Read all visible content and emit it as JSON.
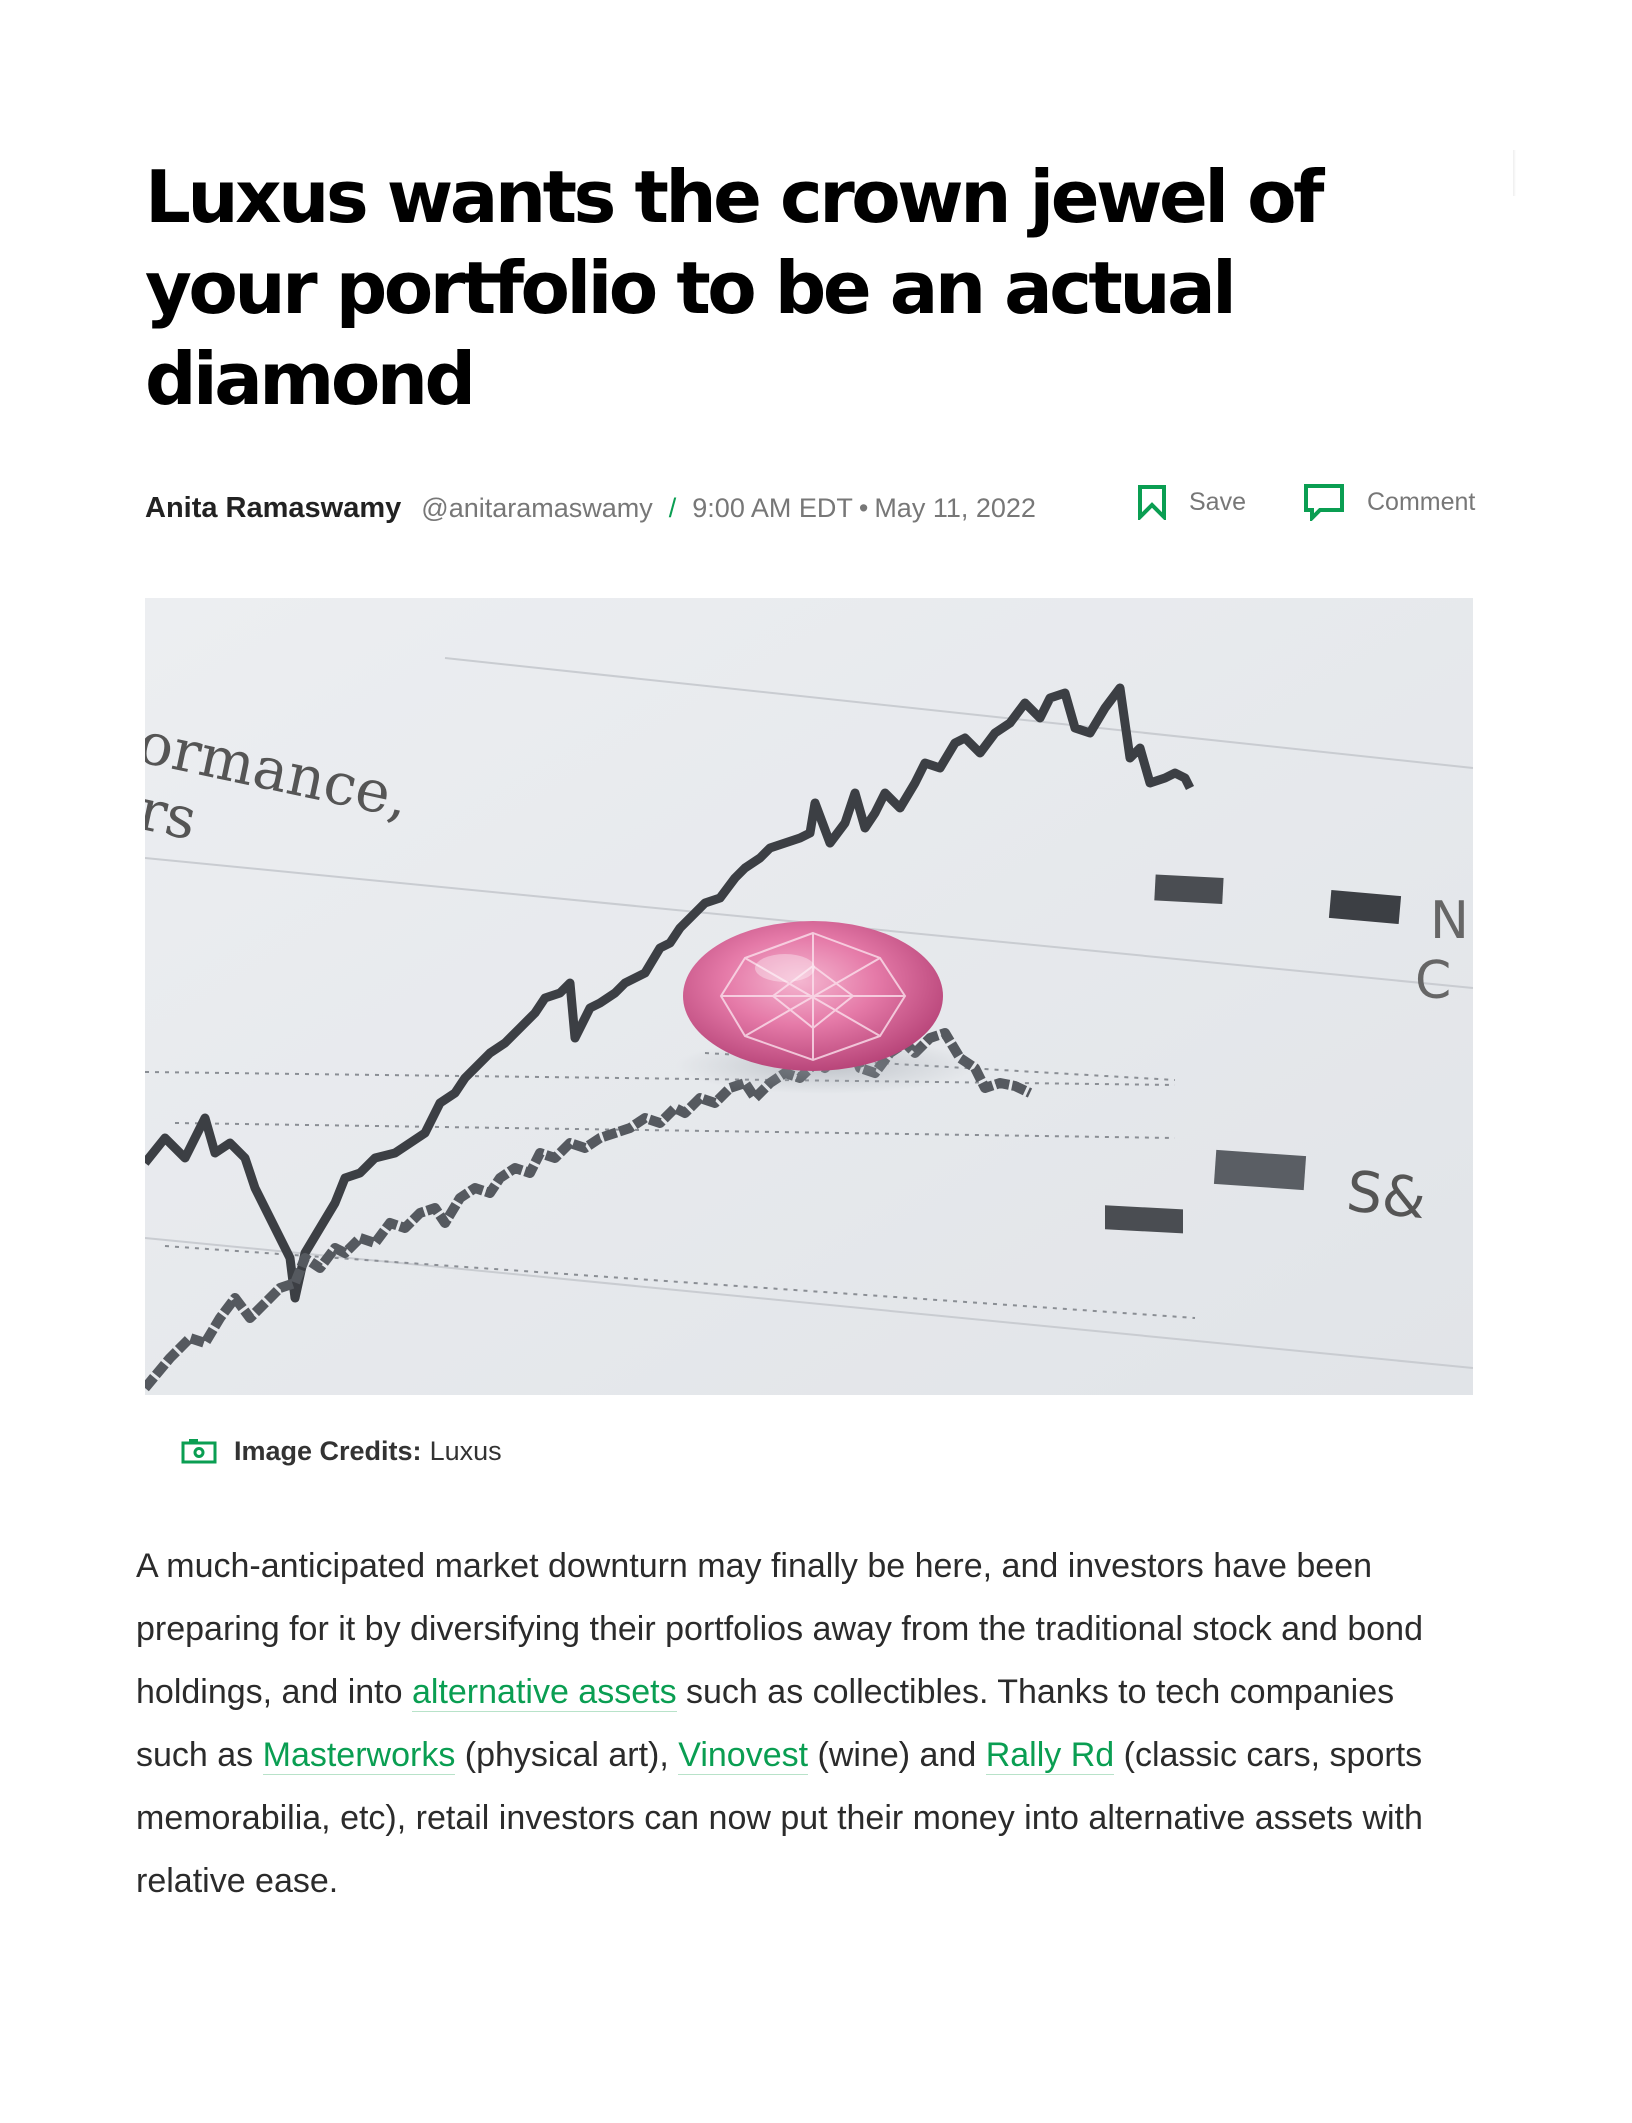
{
  "article": {
    "title": "Luxus wants the crown jewel of your portfolio to be an actual diamond",
    "author": "Anita Ramaswamy",
    "handle": "@anitaramaswamy",
    "separator": "/",
    "time": "9:00 AM EDT",
    "dot": "•",
    "date": "May 11, 2022"
  },
  "actions": {
    "save_label": "Save",
    "comment_label": "Comment"
  },
  "hero": {
    "text_top_line1": "ormance,",
    "text_top_line2": "rs",
    "text_right_1": "N",
    "text_right_2": "C",
    "text_right_3": "S&"
  },
  "credits": {
    "label": "Image Credits:",
    "value": "Luxus"
  },
  "body": {
    "seg1": "A much-anticipated market downturn may finally be here, and investors have been preparing for it by diversifying their portfolios away from the traditional stock and bond holdings, and into ",
    "link1": "alternative assets",
    "seg2": " such as collectibles. Thanks to tech companies such as ",
    "link2": "Masterworks",
    "seg3": " (physical art), ",
    "link3": "Vinovest",
    "seg4": " (wine) and ",
    "link4": "Rally Rd",
    "seg5": " (classic cars, sports memorabilia, etc), retail investors can now put their money into alternative assets with relative ease."
  },
  "colors": {
    "accent": "#0a9e52",
    "title": "#000000",
    "meta": "#777777"
  },
  "icons": {
    "save": "bookmark-icon",
    "comment": "comment-icon",
    "credits": "camera-icon"
  }
}
